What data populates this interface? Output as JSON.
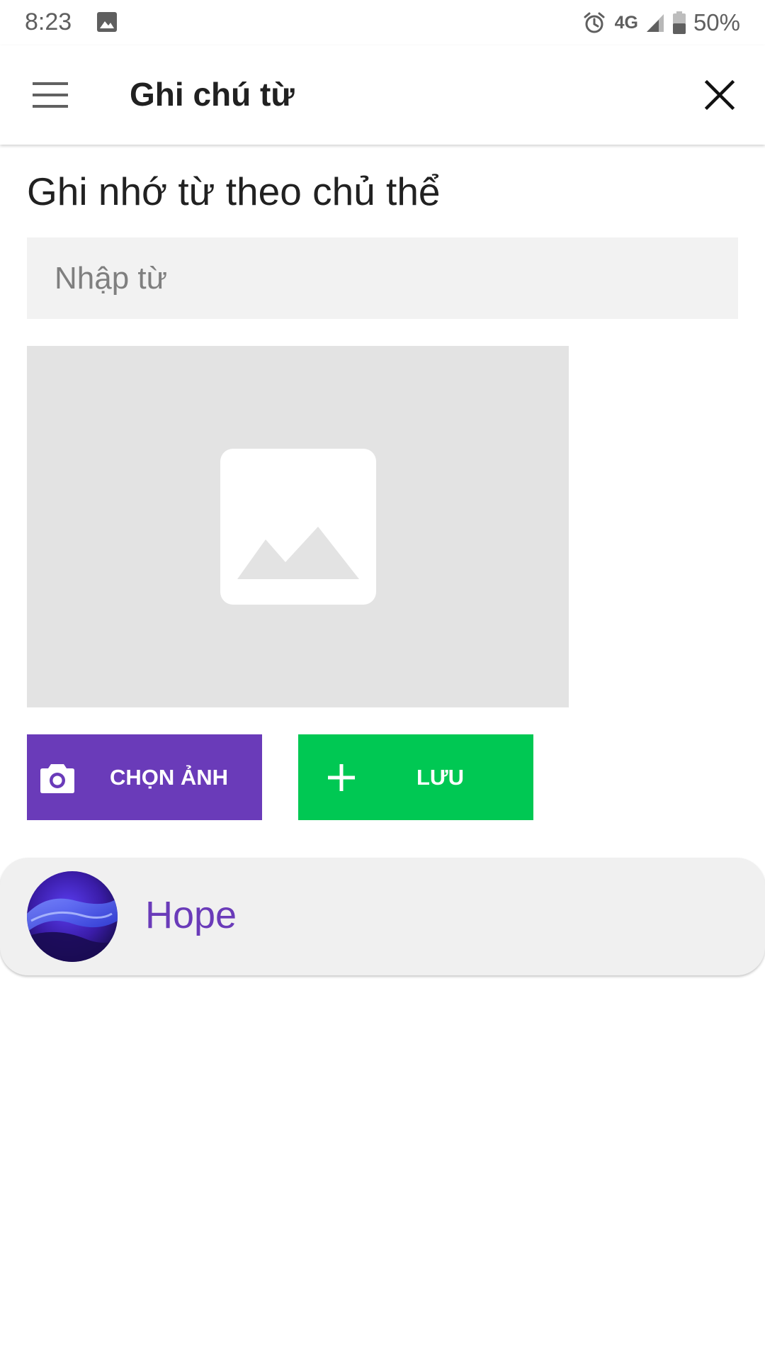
{
  "status_bar": {
    "time": "8:23",
    "network": "4G",
    "battery": "50%",
    "icons": [
      "gallery-icon",
      "alarm-icon",
      "signal-icon",
      "battery-icon"
    ]
  },
  "app_bar": {
    "title": "Ghi chú từ",
    "icons": [
      "menu-icon",
      "close-icon"
    ]
  },
  "main": {
    "heading": "Ghi nhớ từ theo chủ thể",
    "word_input": {
      "value": "",
      "placeholder": "Nhập từ"
    },
    "image_preview_icon": "image-placeholder-icon",
    "buttons": {
      "choose_image": {
        "label": "CHỌN ẢNH",
        "icon": "camera-icon"
      },
      "save": {
        "label": "LƯU",
        "icon": "plus-icon"
      }
    }
  },
  "topics": [
    {
      "name": "Hope",
      "avatar": "abstract-purple-avatar"
    }
  ],
  "colors": {
    "primary_purple": "#6a3bb9",
    "save_green": "#00c853",
    "input_background": "#f2f2f2",
    "preview_background": "#e3e3e3",
    "card_background": "#f0f0f0",
    "text_dark": "#212121",
    "status_gray": "#5f5f5f"
  }
}
